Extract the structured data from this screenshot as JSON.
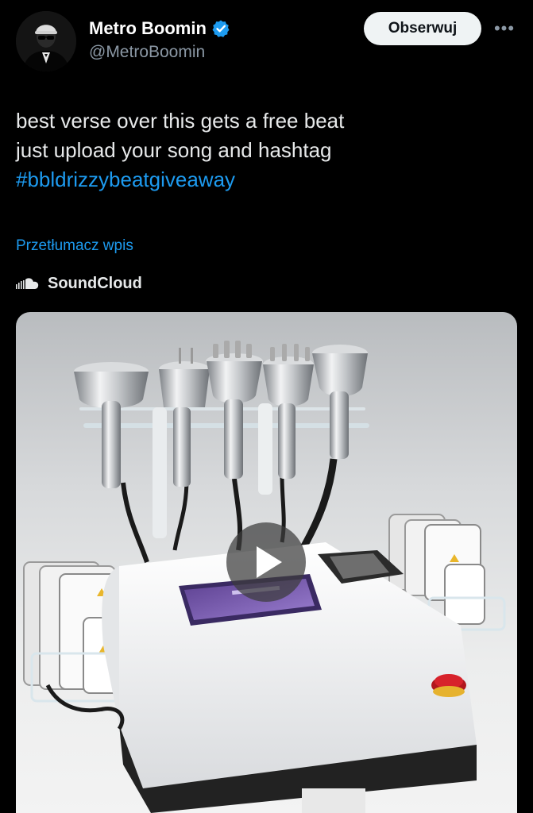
{
  "header": {
    "display_name": "Metro Boomin",
    "handle": "@MetroBoomin",
    "follow_label": "Obserwuj",
    "more_label": "•••",
    "verified": true
  },
  "tweet": {
    "lines": [
      "best verse over this gets a free beat",
      "just upload your song and hashtag"
    ],
    "hashtag": "#bbldrizzybeatgiveaway",
    "translate_label": "Przetłumacz wpis",
    "source_label": "SoundCloud"
  },
  "media": {
    "type": "video",
    "play_icon": "play-icon"
  },
  "colors": {
    "background": "#000000",
    "text": "#e7e9ea",
    "secondary": "#8b98a5",
    "link": "#1d9bf0",
    "verified": "#1d9bf0",
    "follow_button_bg": "#eff3f4"
  }
}
